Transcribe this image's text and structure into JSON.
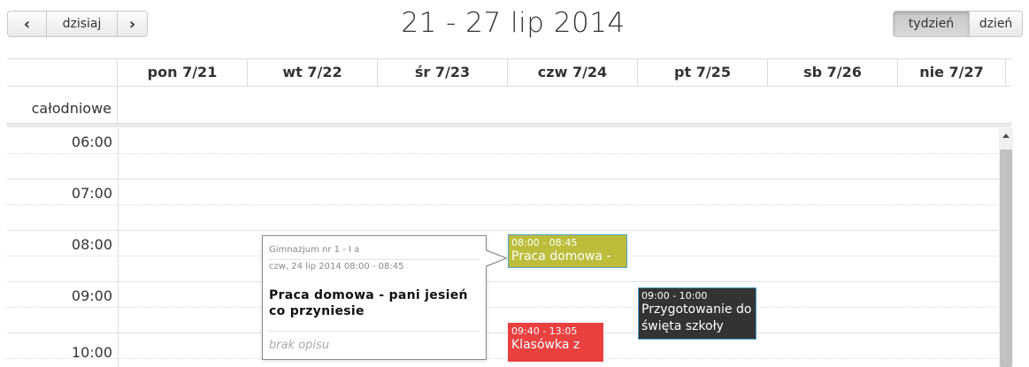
{
  "toolbar": {
    "prev_icon": "chevron-left",
    "today_label": "dzisiaj",
    "next_icon": "chevron-right",
    "title": "21 - 27 lip 2014",
    "views": [
      {
        "label": "tydzień",
        "active": true
      },
      {
        "label": "dzień",
        "active": false
      }
    ]
  },
  "columns": {
    "days": [
      "pon 7/21",
      "wt 7/22",
      "śr 7/23",
      "czw 7/24",
      "pt 7/25",
      "sb 7/26",
      "nie 7/27"
    ]
  },
  "allday": {
    "label": "całodniowe"
  },
  "times": [
    "06:00",
    "07:00",
    "08:00",
    "09:00",
    "10:00"
  ],
  "events": [
    {
      "time": "08:00 - 08:45",
      "title": "Praca domowa -",
      "color": "#bcbd3a"
    },
    {
      "time": "09:00 - 10:00",
      "title": "Przygotowanie do święta szkoły",
      "color": "#333333"
    },
    {
      "time": "09:40 - 13:05",
      "title": "Klasówka z",
      "color": "#e94040"
    }
  ],
  "popup": {
    "organization": "Gimnazjum nr 1 - I a",
    "datetime": "czw, 24 lip 2014 08:00 - 08:45",
    "title": "Praca domowa - pani jesień co przyniesie",
    "description": "brak opisu"
  }
}
